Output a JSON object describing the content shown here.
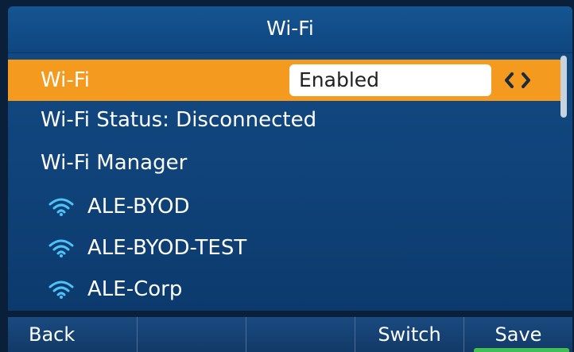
{
  "header": {
    "title": "Wi-Fi"
  },
  "menu": {
    "wifi_label": "Wi-Fi",
    "wifi_value": "Enabled",
    "arrows": "‹›",
    "status": "Wi-Fi Status: Disconnected",
    "manager": "Wi-Fi Manager",
    "networks": [
      {
        "name": "ALE-BYOD"
      },
      {
        "name": "ALE-BYOD-TEST"
      },
      {
        "name": "ALE-Corp"
      }
    ]
  },
  "softkeys": {
    "back": "Back",
    "key2": "",
    "key3": "",
    "switch": "Switch",
    "save": "Save"
  },
  "colors": {
    "accent": "#f39a1f",
    "background": "#0f4278",
    "wifi_icon": "#4fc3f7",
    "save_indicator": "#3fbf55"
  }
}
